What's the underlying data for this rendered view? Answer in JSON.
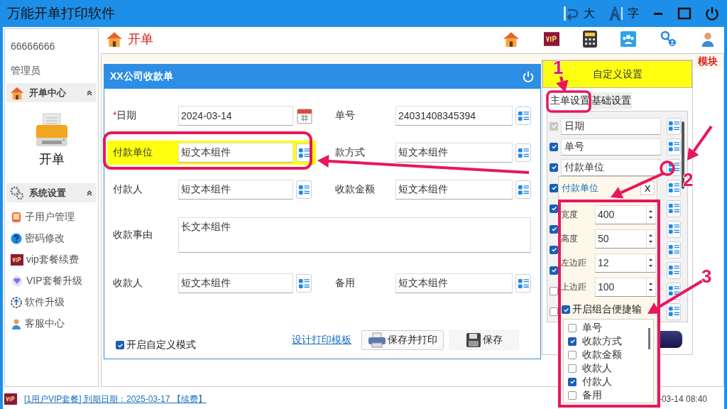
{
  "window": {
    "title": "万能开单打印软件",
    "controls": [
      {
        "kind": "rotate",
        "label": "大"
      },
      {
        "kind": "font",
        "label": "字"
      }
    ]
  },
  "sidebar": {
    "account": "66666666",
    "role": "管理员",
    "sections": [
      {
        "kind": "tiles",
        "title": "开单中心",
        "expanded": true,
        "items": [
          "开单"
        ]
      },
      {
        "kind": "links",
        "title": "系统设置",
        "expanded": true,
        "items": [
          "子用户管理",
          "密码修改",
          "vip套餐续费",
          "VIP套餐升级",
          "软件升级",
          "客服中心"
        ]
      }
    ]
  },
  "header": {
    "title": "开单"
  },
  "module_bar": {
    "label": "模块"
  },
  "form": {
    "title": "XX公司收款单",
    "fields": [
      {
        "kind": "date",
        "required_mark": "*",
        "label": "日期",
        "value": "2024-03-14",
        "highlighted": false
      },
      {
        "kind": "text",
        "label": "单号",
        "value": "24031408345394",
        "highlighted": false
      },
      {
        "kind": "text",
        "label": "付款单位",
        "value": "短文本组件",
        "highlighted": true
      },
      {
        "kind": "text",
        "label": "款方式",
        "value": "短文本组件",
        "highlighted": false
      },
      {
        "kind": "text",
        "label": "付款人",
        "value": "短文本组件",
        "highlighted": false
      },
      {
        "kind": "text",
        "label": "收款金额",
        "value": "短文本组件",
        "highlighted": false
      },
      {
        "kind": "textarea",
        "label": "收款事由",
        "value": "长文本组件",
        "highlighted": false
      },
      {
        "kind": "text",
        "label": "收款人",
        "value": "短文本组件",
        "highlighted": false
      },
      {
        "kind": "text",
        "label": "备用",
        "value": "短文本组件",
        "highlighted": false
      }
    ],
    "custom_mode": {
      "label": "开启自定义模式",
      "checked": true
    },
    "link": "设计打印模板",
    "buttons": [
      {
        "kind": "print",
        "label": "保存并打印"
      },
      {
        "kind": "save",
        "label": "保存"
      }
    ]
  },
  "settings": {
    "title": "自定义设置",
    "tabs": [
      {
        "label": "主单设置",
        "selected": true
      },
      {
        "label": "基础设置",
        "selected": false
      }
    ],
    "rows": [
      {
        "label": "日期",
        "checked": true,
        "disabled": true
      },
      {
        "label": "单号",
        "checked": true,
        "disabled": false
      },
      {
        "label": "付款单位",
        "checked": true,
        "disabled": false
      },
      {
        "checked": true,
        "disabled": false
      },
      {
        "checked": true,
        "disabled": false
      },
      {
        "checked": true,
        "disabled": false
      },
      {
        "checked": true,
        "disabled": false
      },
      {
        "checked": true,
        "disabled": false
      },
      {
        "checked": false,
        "disabled": false
      },
      {
        "checked": false,
        "disabled": false
      }
    ]
  },
  "popup": {
    "title": "付款单位",
    "close": "X",
    "fields": [
      {
        "label": "宽度",
        "value": "400"
      },
      {
        "label": "高度",
        "value": "50"
      },
      {
        "label": "左边距",
        "value": "12"
      },
      {
        "label": "上边距",
        "value": "100"
      }
    ],
    "combo": {
      "label": "开启组合便捷输",
      "checked": true
    },
    "options": [
      {
        "label": "单号",
        "checked": false
      },
      {
        "label": "收款方式",
        "checked": true
      },
      {
        "label": "收款金额",
        "checked": false
      },
      {
        "label": "收款人",
        "checked": false
      },
      {
        "label": "付款人",
        "checked": true
      },
      {
        "label": "备用",
        "checked": false
      }
    ]
  },
  "status_bar": {
    "link": "[1用户VIP套餐] 到期日期：2025-03-17 【续费】",
    "time": "-03-14 08:40"
  },
  "annotations": {
    "markers": [
      "1",
      "2",
      "3"
    ]
  }
}
